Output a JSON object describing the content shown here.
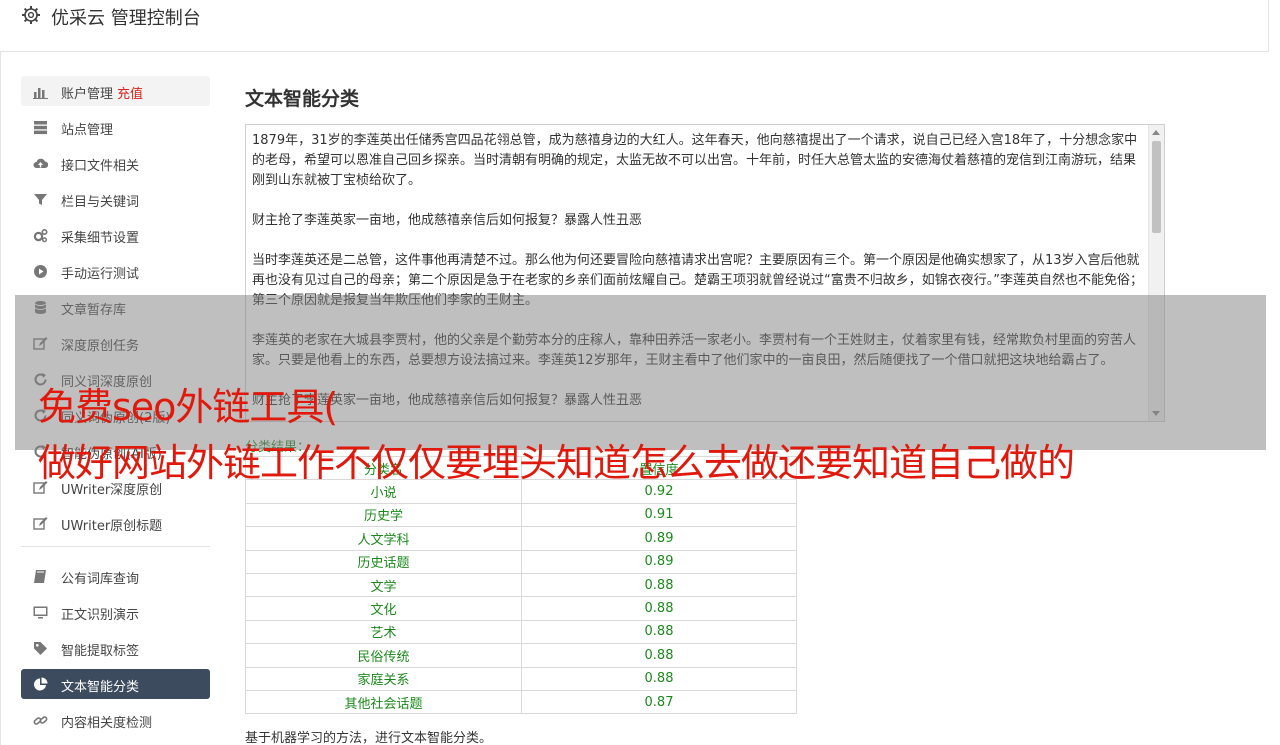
{
  "header": {
    "title": "优采云 管理控制台",
    "icon": "gear-icon"
  },
  "sidebar": {
    "group1": [
      {
        "label": "账户管理",
        "badge": "充值",
        "icon": "bar-chart-icon",
        "state": "highlight"
      },
      {
        "label": "站点管理",
        "icon": "server-icon"
      },
      {
        "label": "接口文件相关",
        "icon": "cloud-upload-icon"
      },
      {
        "label": "栏目与关键词",
        "icon": "filter-icon"
      },
      {
        "label": "采集细节设置",
        "icon": "cogs-icon"
      },
      {
        "label": "手动运行测试",
        "icon": "play-circle-icon"
      },
      {
        "label": "文章暂存库",
        "icon": "database-icon"
      },
      {
        "label": "深度原创任务",
        "icon": "edit-icon"
      },
      {
        "label": "同义词深度原创",
        "icon": "refresh-icon"
      },
      {
        "label": "同义词伪原创(2版)",
        "icon": "refresh-icon"
      },
      {
        "label": "智能伪原创(AI版)",
        "icon": "refresh-icon"
      },
      {
        "label": "UWriter深度原创",
        "icon": "edit-icon"
      },
      {
        "label": "UWriter原创标题",
        "icon": "edit-icon"
      }
    ],
    "group2": [
      {
        "label": "公有词库查询",
        "icon": "book-icon"
      },
      {
        "label": "正文识别演示",
        "icon": "monitor-icon"
      },
      {
        "label": "智能提取标签",
        "icon": "tag-icon"
      },
      {
        "label": "文本智能分类",
        "icon": "pie-chart-icon",
        "state": "active"
      },
      {
        "label": "内容相关度检测",
        "icon": "link-icon"
      }
    ]
  },
  "main": {
    "title": "文本智能分类",
    "paragraphs": [
      "1879年，31岁的李莲英出任储秀宫四品花翎总管，成为慈禧身边的大红人。这年春天，他向慈禧提出了一个请求，说自己已经入宫18年了，十分想念家中的老母，希望可以恩准自己回乡探亲。当时清朝有明确的规定，太监无故不可以出宫。十年前，时任大总管太监的安德海仗着慈禧的宠信到江南游玩，结果刚到山东就被丁宝桢给砍了。",
      "财主抢了李莲英家一亩地，他成慈禧亲信后如何报复？暴露人性丑恶",
      "当时李莲英还是二总管，这件事他再清楚不过。那么他为何还要冒险向慈禧请求出宫呢？主要原因有三个。第一个原因是他确实想家了，从13岁入宫后他就再也没有见过自己的母亲；第二个原因是急于在老家的乡亲们面前炫耀自己。楚霸王项羽就曾经说过“富贵不归故乡，如锦衣夜行。”李莲英自然也不能免俗；第三个原因就是报复当年欺压他们李家的王财主。",
      "李莲英的老家在大城县李贾村，他的父亲是个勤劳本分的庄稼人，靠种田养活一家老小。李贾村有一个王姓财主，仗着家里有钱，经常欺负村里面的穷苦人家。只要是他看上的东西，总要想方设法搞过来。李莲英12岁那年，王财主看中了他们家中的一亩良田，然后随便找了一个借口就把这块地给霸占了。",
      "财主抢了李莲英家一亩地，他成慈禧亲信后如何报复？暴露人性丑恶"
    ],
    "result_label": "分类结果：",
    "table": {
      "headers": [
        "分类名",
        "置信度"
      ],
      "rows": [
        [
          "小说",
          "0.92"
        ],
        [
          "历史学",
          "0.91"
        ],
        [
          "人文学科",
          "0.89"
        ],
        [
          "历史话题",
          "0.89"
        ],
        [
          "文学",
          "0.88"
        ],
        [
          "文化",
          "0.88"
        ],
        [
          "艺术",
          "0.88"
        ],
        [
          "民俗传统",
          "0.88"
        ],
        [
          "家庭关系",
          "0.88"
        ],
        [
          "其他社会话题",
          "0.87"
        ]
      ]
    },
    "footnote": "基于机器学习的方法，进行文本智能分类。"
  },
  "overlay": {
    "line1": "免费seo外链工具(",
    "line2": "做好网站外链工作不仅仅要埋头知道怎么去做还要知道自己做的"
  },
  "colors": {
    "accent_active": "#3d4b5e",
    "badge": "#d9251d",
    "result_text": "#1b8a1b",
    "overlay_text": "#e0190c"
  }
}
